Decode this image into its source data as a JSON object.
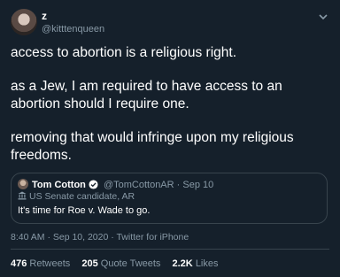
{
  "author": {
    "display_name": "z",
    "handle": "@kitttenqueen"
  },
  "tweet": {
    "paragraphs": [
      "access to abortion is a religious right.",
      "as a Jew, I am required to have access to an abortion should I require one.",
      "removing that would infringe upon my religious freedoms."
    ]
  },
  "quoted_tweet": {
    "name": "Tom Cotton",
    "handle": "@TomCottonAR",
    "separator": "·",
    "date": "Sep 10",
    "label": "US Senate candidate, AR",
    "text": "It's time for Roe v. Wade to go."
  },
  "meta": {
    "timestamp": "8:40 AM · Sep 10, 2020 · Twitter for iPhone"
  },
  "stats": {
    "retweets_count": "476",
    "retweets_label": "Retweets",
    "quote_count": "205",
    "quote_label": "Quote Tweets",
    "likes_count": "2.2K",
    "likes_label": "Likes"
  },
  "colors": {
    "background": "#15202b",
    "secondary_text": "#8899a6",
    "border": "#38444d",
    "verified": "#1da1f2"
  },
  "icons": [
    "chevron-down-icon",
    "verified-badge-icon",
    "government-building-icon"
  ]
}
